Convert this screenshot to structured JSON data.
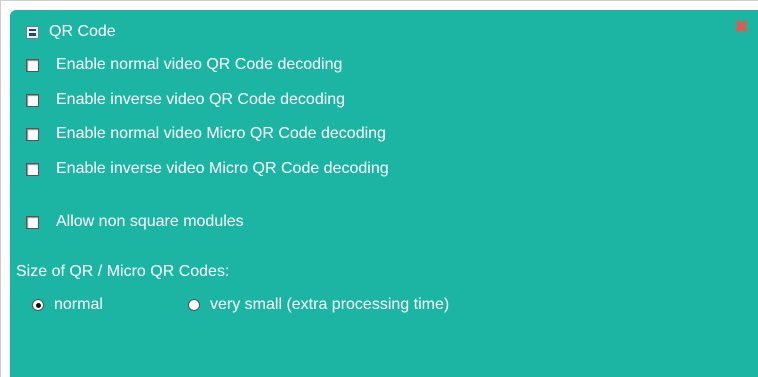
{
  "panel": {
    "title": "QR Code",
    "collapse_icon": "collapse-icon",
    "close_icon": "close-x-icon"
  },
  "options": [
    {
      "label": "Enable normal video QR Code decoding",
      "checked": false
    },
    {
      "label": "Enable inverse video QR Code decoding",
      "checked": false
    },
    {
      "label": "Enable normal video Micro QR Code decoding",
      "checked": false
    },
    {
      "label": "Enable inverse video Micro QR Code decoding",
      "checked": false
    },
    {
      "label": "Allow non square modules",
      "checked": false
    }
  ],
  "size": {
    "label": "Size of QR / Micro QR Codes:",
    "options": [
      {
        "label": "normal",
        "selected": true
      },
      {
        "label": "very small (extra processing time)",
        "selected": false
      }
    ]
  },
  "colors": {
    "panel_bg": "#1cb5a3",
    "text": "#ffffff",
    "close": "#e05a4f"
  }
}
